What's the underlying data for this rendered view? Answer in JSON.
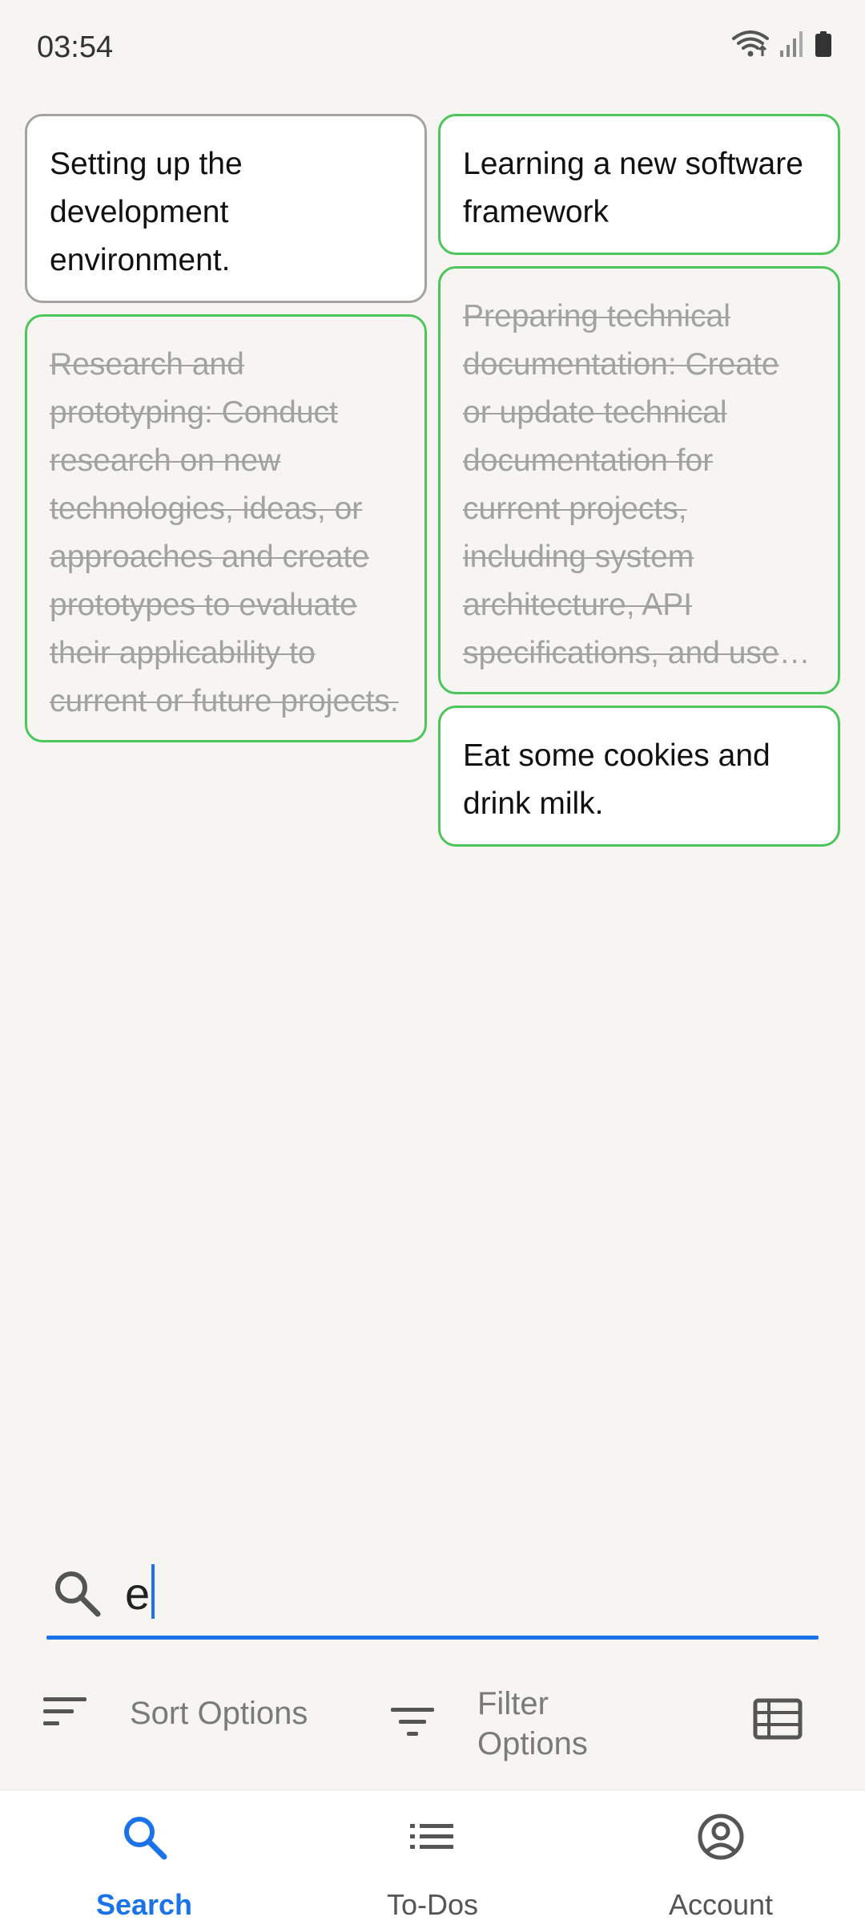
{
  "status_bar": {
    "time": "03:54"
  },
  "notes": [
    {
      "text": "Setting up the development environment."
    },
    {
      "text": "Learning a new software framework"
    },
    {
      "text": "Research and prototyping: Conduct research on new technologies, ideas, or approaches and create prototypes to evaluate their applicability to current or future projects."
    },
    {
      "text": "Preparing technical documentation: Create or update technical documentation for current projects, including system architecture, API specifications, and user guides."
    },
    {
      "text": "Eat some cookies and drink milk."
    }
  ],
  "search": {
    "value": "e"
  },
  "options": {
    "sort_label": "Sort Options",
    "filter_label": "Filter Options"
  },
  "nav": {
    "items": [
      {
        "label": "Search",
        "icon": "search-icon"
      },
      {
        "label": "To-Dos",
        "icon": "list-icon"
      },
      {
        "label": "Account",
        "icon": "account-icon"
      }
    ]
  },
  "colors": {
    "accent": "#1a73e8",
    "card_border_active": "#4cc65a",
    "card_border_neutral": "#a3a3a0",
    "completed_text": "#a2a2a2",
    "background": "#f6f5f2"
  }
}
